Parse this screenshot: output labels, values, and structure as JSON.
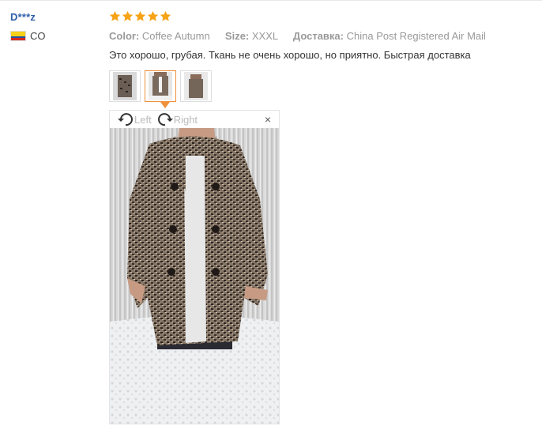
{
  "user": {
    "name": "D***z",
    "country_code": "CO"
  },
  "review": {
    "rating": 5,
    "attributes": [
      {
        "key": "Color:",
        "value": "Coffee Autumn"
      },
      {
        "key": "Size:",
        "value": "XXXL"
      },
      {
        "key": "Доставка:",
        "value": "China Post Registered Air Mail"
      }
    ],
    "text": "Это хорошо, грубая. Ткань не очень хорошо, но приятно. Быстрая доставка"
  },
  "viewer": {
    "rotate_left_label": "Left",
    "rotate_right_label": "Right",
    "close_label": "×"
  },
  "colors": {
    "star": "#f6a316",
    "username": "#2f5fa8",
    "active_thumb_border": "#f0903a"
  },
  "icons": {
    "star": "star-icon",
    "rotate_left": "rotate-left-icon",
    "rotate_right": "rotate-right-icon",
    "close": "close-icon",
    "flag": "colombia-flag-icon"
  }
}
